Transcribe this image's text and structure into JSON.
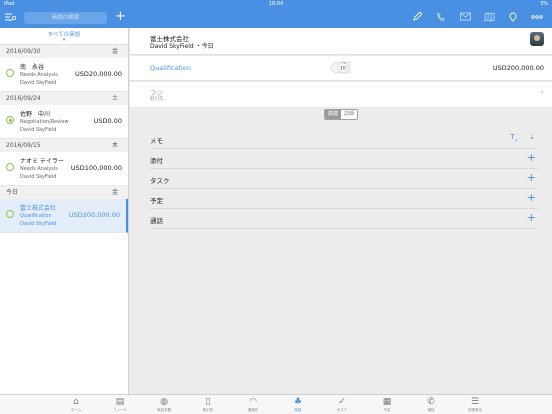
{
  "status": {
    "device": "iPad",
    "time": "18:04",
    "battery": "3%"
  },
  "nav": {
    "search_placeholder": "商談の検索",
    "icons": [
      "filter-icon",
      "add-icon",
      "edit-icon",
      "phone-icon",
      "mail-icon",
      "map-icon",
      "location-icon",
      "more-icon"
    ]
  },
  "list": {
    "filter_label": "すべての商談",
    "groups": [
      {
        "date": "2016/09/30",
        "weekday": "金",
        "items": [
          {
            "name": "南　永谷",
            "stage": "Needs Analysis",
            "owner": "David SkyField",
            "amount": "USD20,000.00"
          }
        ]
      },
      {
        "date": "2016/09/24",
        "weekday": "土",
        "items": [
          {
            "name": "佐野　中川",
            "stage": "Negotiation/Review",
            "owner": "David SkyField",
            "amount": "USD0.00"
          }
        ]
      },
      {
        "date": "2016/09/15",
        "weekday": "木",
        "items": [
          {
            "name": "ナオミ テイラー",
            "stage": "Needs Analysis",
            "owner": "David SkyField",
            "amount": "USD100,000.00"
          }
        ]
      },
      {
        "date": "今日",
        "weekday": "金",
        "items": [
          {
            "name": "富士株式会社",
            "stage": "Qualification",
            "owner": "David SkyField",
            "amount": "USD200,000.00"
          }
        ]
      }
    ]
  },
  "detail": {
    "company": "富士株式会社",
    "owner_line": "David SkyField ・今日",
    "stage": "Qualification",
    "probability": "10",
    "probability_fraction": 0.1,
    "amount": "USD200,000.00",
    "contact_name": "フジ",
    "contact_role": "取引先",
    "segments": [
      "関連",
      "詳細"
    ],
    "sections": [
      "メモ",
      "添付",
      "タスク",
      "予定",
      "通話"
    ]
  },
  "tabs": [
    "ホーム",
    "フィード",
    "商品本棚",
    "取引先",
    "連絡先",
    "商談",
    "タスク",
    "予定",
    "通話",
    "詳細表示"
  ],
  "colors": {
    "accent": "#4a90e2",
    "status_green": "#8bc34a"
  }
}
